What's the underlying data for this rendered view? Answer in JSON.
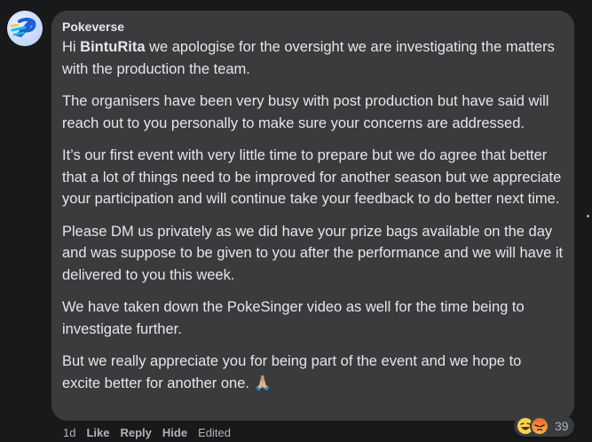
{
  "comment": {
    "author": "Pokeverse",
    "avatar_icon": "pokeverse-logo-icon",
    "greeting_prefix": "Hi ",
    "mention": "BintuRita",
    "greeting_rest": " we apologise for the oversight we are investigating the matters with the production the team.",
    "paragraphs": [
      "The organisers have been very busy with post production but have said will reach out to you personally to make sure your concerns are addressed.",
      "It’s our first event with very little time to prepare but we do agree that better that a lot of things need to be improved for another season but we appreciate your participation and will continue take your feedback to do better next time.",
      "Please DM us privately as we did have your prize bags available on the day and was suppose to be given to you after the performance and we will have it delivered to you this week.",
      "We have taken down the PokeSinger video as well for the time being to investigate further."
    ],
    "last_paragraph": "But we really appreciate you for being part of the event and we hope to excite better for another one.",
    "last_emoji": "🙏🏼"
  },
  "reactions": {
    "icons": [
      "haha-icon",
      "angry-icon"
    ],
    "count": "39"
  },
  "actions": {
    "time": "1d",
    "like": "Like",
    "reply": "Reply",
    "hide": "Hide",
    "edited": "Edited"
  },
  "colors": {
    "page_bg": "#18191a",
    "bubble_bg": "#3a3b3c",
    "text": "#e4e6eb",
    "muted": "#b0b3b8",
    "haha": "#f7d154",
    "angry": "#e9662c"
  }
}
